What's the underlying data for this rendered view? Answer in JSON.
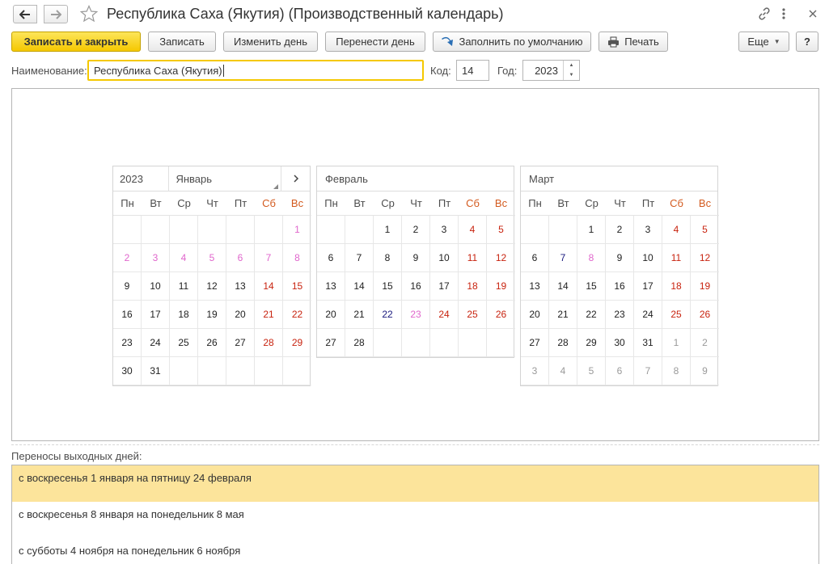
{
  "window": {
    "title": "Республика Саха (Якутия) (Производственный календарь)"
  },
  "toolbar": {
    "save_close": "Записать и закрыть",
    "save": "Записать",
    "change_day": "Изменить день",
    "move_day": "Перенести день",
    "fill_default": "Заполнить по умолчанию",
    "print": "Печать",
    "more": "Еще",
    "help": "?"
  },
  "fields": {
    "name_label": "Наименование:",
    "name_value": "Республика Саха (Якутия)",
    "code_label": "Код:",
    "code_value": "14",
    "year_label": "Год:",
    "year_value": "2023"
  },
  "calendar": {
    "year": "2023",
    "selected_month": "Январь",
    "weekdays": [
      "Пн",
      "Вт",
      "Ср",
      "Чт",
      "Пт",
      "Сб",
      "Вс"
    ],
    "colors": {
      "weekday": "#222222",
      "holiday": "#c8230f",
      "holiday_period": "#e066cc",
      "pre_holiday": "#1a1a7e",
      "other_month": "#9a9a9a"
    },
    "months": [
      {
        "name": "Январь",
        "days": [
          [
            "",
            ""
          ],
          [
            "",
            ""
          ],
          [
            "",
            ""
          ],
          [
            "",
            ""
          ],
          [
            "",
            ""
          ],
          [
            "",
            ""
          ],
          [
            "1",
            "pink"
          ],
          [
            "2",
            "pink"
          ],
          [
            "3",
            "pink"
          ],
          [
            "4",
            "pink"
          ],
          [
            "5",
            "pink"
          ],
          [
            "6",
            "pink"
          ],
          [
            "7",
            "pink"
          ],
          [
            "8",
            "pink"
          ],
          [
            "9",
            ""
          ],
          [
            "10",
            ""
          ],
          [
            "11",
            ""
          ],
          [
            "12",
            ""
          ],
          [
            "13",
            ""
          ],
          [
            "14",
            "red"
          ],
          [
            "15",
            "red"
          ],
          [
            "16",
            ""
          ],
          [
            "17",
            ""
          ],
          [
            "18",
            ""
          ],
          [
            "19",
            ""
          ],
          [
            "20",
            ""
          ],
          [
            "21",
            "red"
          ],
          [
            "22",
            "red"
          ],
          [
            "23",
            ""
          ],
          [
            "24",
            ""
          ],
          [
            "25",
            ""
          ],
          [
            "26",
            ""
          ],
          [
            "27",
            ""
          ],
          [
            "28",
            "red"
          ],
          [
            "29",
            "red"
          ],
          [
            "30",
            ""
          ],
          [
            "31",
            ""
          ],
          [
            "",
            ""
          ],
          [
            "",
            ""
          ],
          [
            "",
            ""
          ],
          [
            "",
            ""
          ],
          [
            "",
            ""
          ]
        ]
      },
      {
        "name": "Февраль",
        "days": [
          [
            "",
            ""
          ],
          [
            "",
            ""
          ],
          [
            "1",
            ""
          ],
          [
            "2",
            ""
          ],
          [
            "3",
            ""
          ],
          [
            "4",
            "red"
          ],
          [
            "5",
            "red"
          ],
          [
            "6",
            ""
          ],
          [
            "7",
            ""
          ],
          [
            "8",
            ""
          ],
          [
            "9",
            ""
          ],
          [
            "10",
            ""
          ],
          [
            "11",
            "red"
          ],
          [
            "12",
            "red"
          ],
          [
            "13",
            ""
          ],
          [
            "14",
            ""
          ],
          [
            "15",
            ""
          ],
          [
            "16",
            ""
          ],
          [
            "17",
            ""
          ],
          [
            "18",
            "red"
          ],
          [
            "19",
            "red"
          ],
          [
            "20",
            ""
          ],
          [
            "21",
            ""
          ],
          [
            "22",
            "dark"
          ],
          [
            "23",
            "pink"
          ],
          [
            "24",
            "red"
          ],
          [
            "25",
            "red"
          ],
          [
            "26",
            "red"
          ],
          [
            "27",
            ""
          ],
          [
            "28",
            ""
          ],
          [
            "",
            ""
          ],
          [
            "",
            ""
          ],
          [
            "",
            ""
          ],
          [
            "",
            ""
          ],
          [
            "",
            ""
          ]
        ]
      },
      {
        "name": "Март",
        "days": [
          [
            "",
            ""
          ],
          [
            "",
            ""
          ],
          [
            "1",
            ""
          ],
          [
            "2",
            ""
          ],
          [
            "3",
            ""
          ],
          [
            "4",
            "red"
          ],
          [
            "5",
            "red"
          ],
          [
            "6",
            ""
          ],
          [
            "7",
            "dark"
          ],
          [
            "8",
            "pink"
          ],
          [
            "9",
            ""
          ],
          [
            "10",
            ""
          ],
          [
            "11",
            "red"
          ],
          [
            "12",
            "red"
          ],
          [
            "13",
            ""
          ],
          [
            "14",
            ""
          ],
          [
            "15",
            ""
          ],
          [
            "16",
            ""
          ],
          [
            "17",
            ""
          ],
          [
            "18",
            "red"
          ],
          [
            "19",
            "red"
          ],
          [
            "20",
            ""
          ],
          [
            "21",
            ""
          ],
          [
            "22",
            ""
          ],
          [
            "23",
            ""
          ],
          [
            "24",
            ""
          ],
          [
            "25",
            "red"
          ],
          [
            "26",
            "red"
          ],
          [
            "27",
            ""
          ],
          [
            "28",
            ""
          ],
          [
            "29",
            ""
          ],
          [
            "30",
            ""
          ],
          [
            "31",
            ""
          ],
          [
            "1",
            "grey"
          ],
          [
            "2",
            "grey"
          ],
          [
            "3",
            "grey"
          ],
          [
            "4",
            "grey"
          ],
          [
            "5",
            "grey"
          ],
          [
            "6",
            "grey"
          ],
          [
            "7",
            "grey"
          ],
          [
            "8",
            "grey"
          ],
          [
            "9",
            "grey"
          ]
        ]
      }
    ]
  },
  "transfers": {
    "label": "Переносы выходных дней:",
    "items": [
      "с воскресенья 1 января на пятницу 24 февраля",
      "с воскресенья 8 января на понедельник 8 мая",
      "с субботы 4 ноября на понедельник 6 ноября"
    ]
  }
}
